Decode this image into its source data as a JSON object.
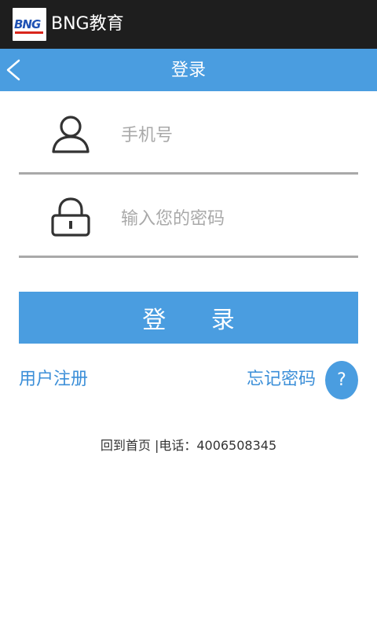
{
  "app": {
    "title": "BNG教育",
    "logo_text": "BNG"
  },
  "nav": {
    "title": "登录"
  },
  "form": {
    "phone_placeholder": "手机号",
    "password_placeholder": "输入您的密码",
    "login_button": "登 录"
  },
  "links": {
    "register": "用户注册",
    "forgot_password": "忘记密码",
    "help": "?"
  },
  "footer": {
    "text": "回到首页 |电话：4006508345"
  },
  "colors": {
    "accent": "#4a9de0",
    "link": "#3c8fd8",
    "titlebar": "#1e1e1e"
  },
  "icons": {
    "back": "chevron-left-icon",
    "user": "user-icon",
    "lock": "lock-icon",
    "help": "question-icon"
  }
}
